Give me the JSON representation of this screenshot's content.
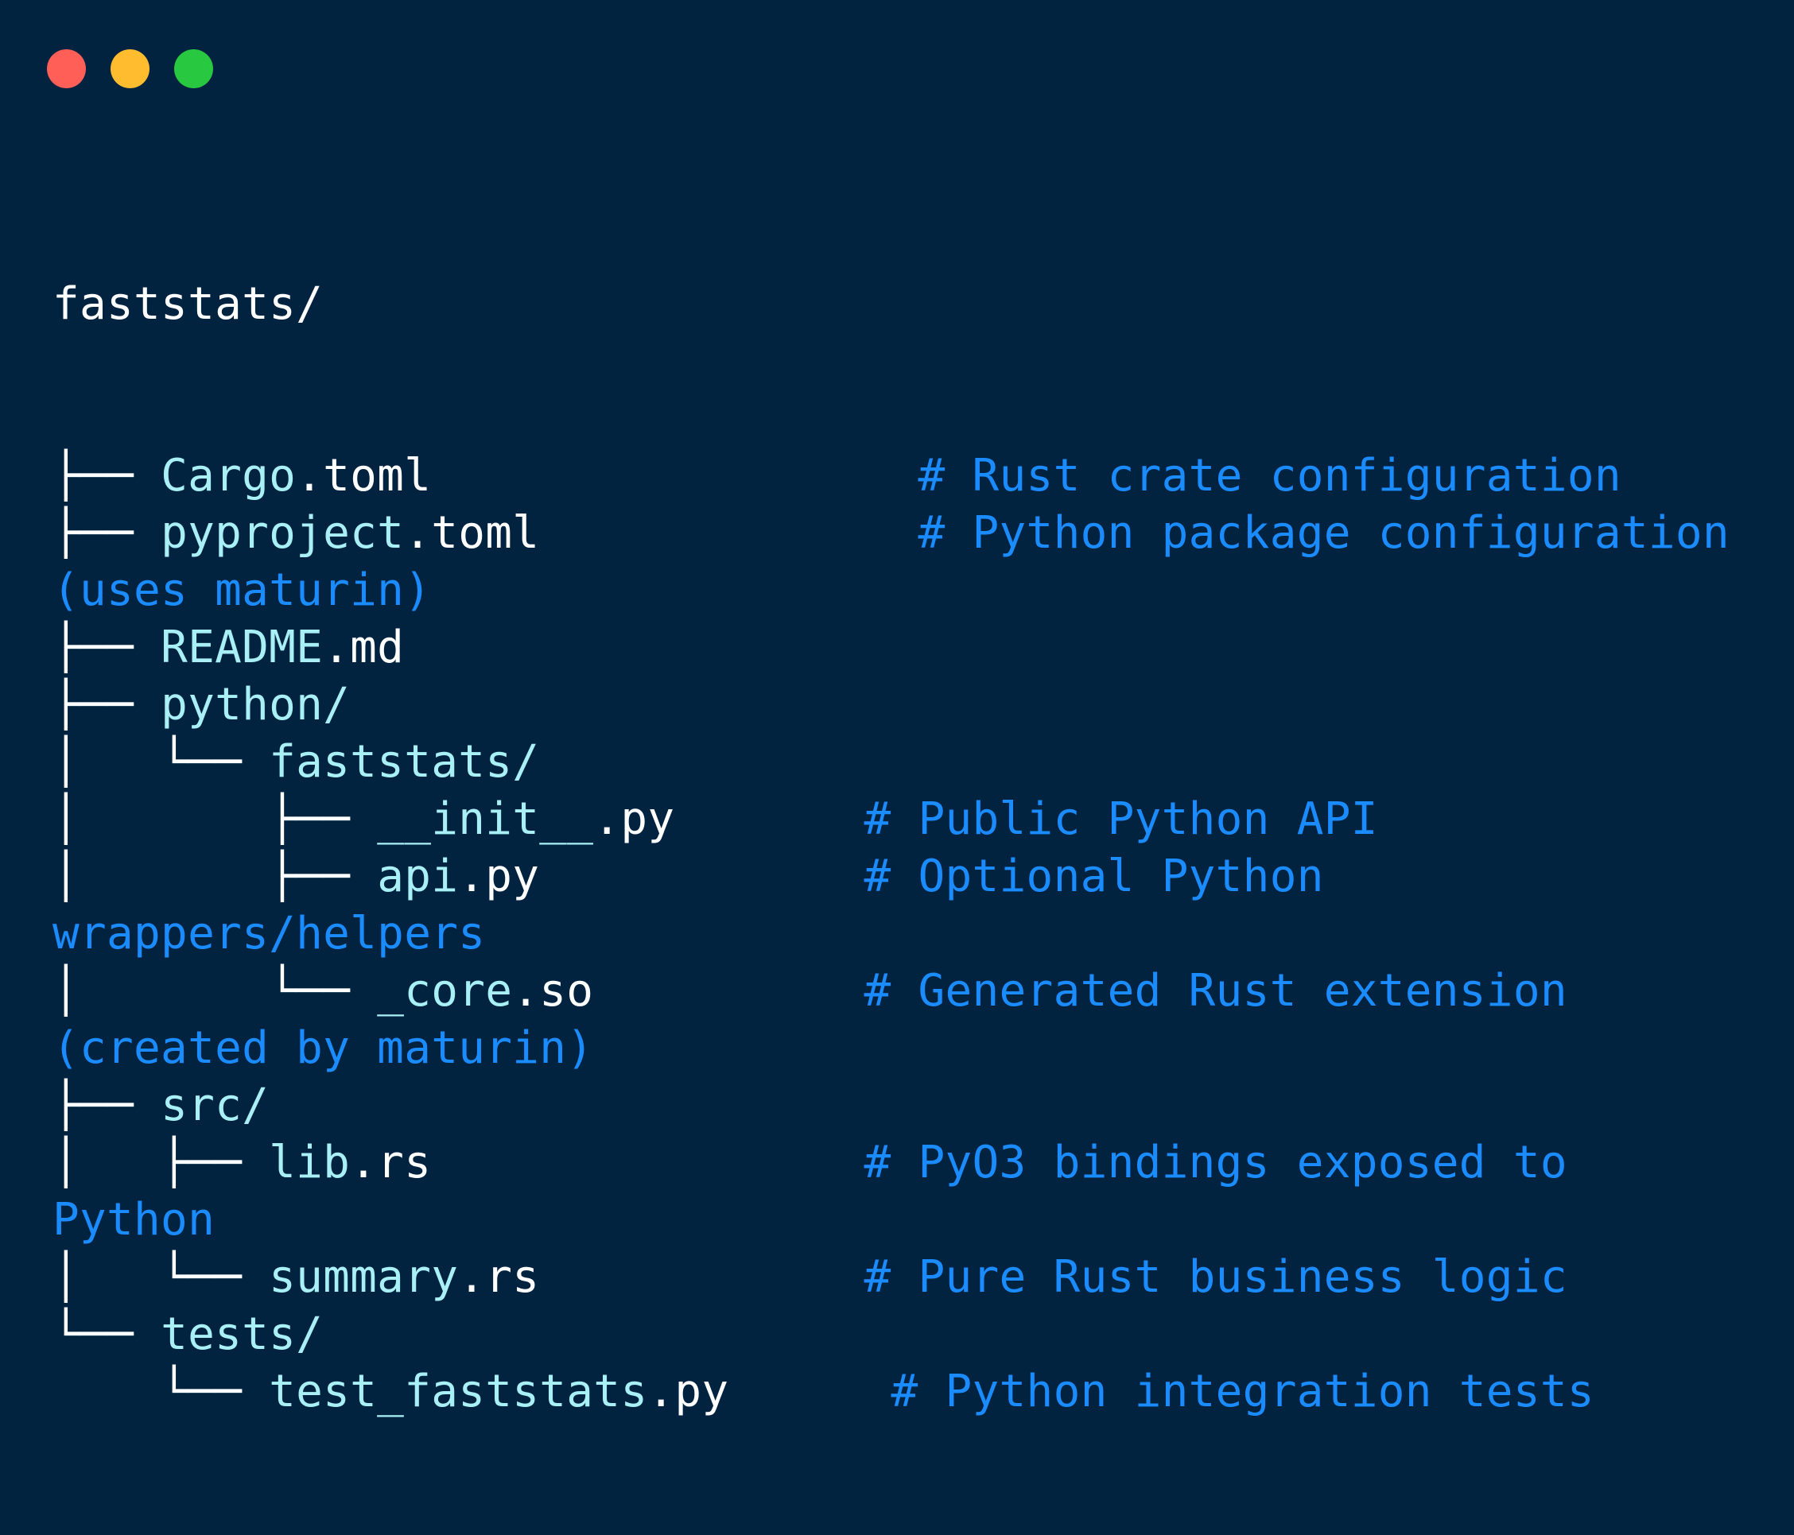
{
  "window": {
    "controls": [
      "close",
      "minimize",
      "zoom"
    ],
    "colors": {
      "background": "#012340",
      "close": "#ff5f57",
      "minimize": "#febc2e",
      "zoom": "#28c840",
      "filename": "#a8f0f6",
      "comment": "#1a8cff"
    }
  },
  "tree": {
    "root": "faststats/",
    "lines": [
      {
        "prefix": "├── ",
        "stem": "Cargo",
        "ext": ".toml",
        "pad": "                  ",
        "comment": "# Rust crate configuration"
      },
      {
        "prefix": "├── ",
        "stem": "pyproject",
        "ext": ".toml",
        "pad": "              ",
        "comment": "# Python package configuration"
      },
      {
        "wrap": "(uses maturin)"
      },
      {
        "prefix": "├── ",
        "stem": "README",
        "ext": ".md",
        "pad": "",
        "comment": ""
      },
      {
        "prefix": "├── ",
        "stem": "python/",
        "ext": "",
        "pad": "",
        "comment": ""
      },
      {
        "prefix": "│   └── ",
        "stem": "faststats/",
        "ext": "",
        "pad": "",
        "comment": ""
      },
      {
        "prefix": "│       ├── ",
        "stem": "__init__",
        "ext": ".py",
        "pad": "       ",
        "comment": "# Public Python API"
      },
      {
        "prefix": "│       ├── ",
        "stem": "api",
        "ext": ".py",
        "pad": "            ",
        "comment": "# Optional Python"
      },
      {
        "wrap": "wrappers/helpers"
      },
      {
        "prefix": "│       └── ",
        "stem": "_core",
        "ext": ".so",
        "pad": "          ",
        "comment": "# Generated Rust extension"
      },
      {
        "wrap": "(created by maturin)"
      },
      {
        "prefix": "├── ",
        "stem": "src/",
        "ext": "",
        "pad": "",
        "comment": ""
      },
      {
        "prefix": "│   ├── ",
        "stem": "lib",
        "ext": ".rs",
        "pad": "                ",
        "comment": "# PyO3 bindings exposed to"
      },
      {
        "wrap": "Python"
      },
      {
        "prefix": "│   └── ",
        "stem": "summary",
        "ext": ".rs",
        "pad": "            ",
        "comment": "# Pure Rust business logic"
      },
      {
        "prefix": "└── ",
        "stem": "tests/",
        "ext": "",
        "pad": "",
        "comment": ""
      },
      {
        "prefix": "    └── ",
        "stem": "test_faststats",
        "ext": ".py",
        "pad": "      ",
        "comment": "# Python integration tests"
      }
    ]
  }
}
